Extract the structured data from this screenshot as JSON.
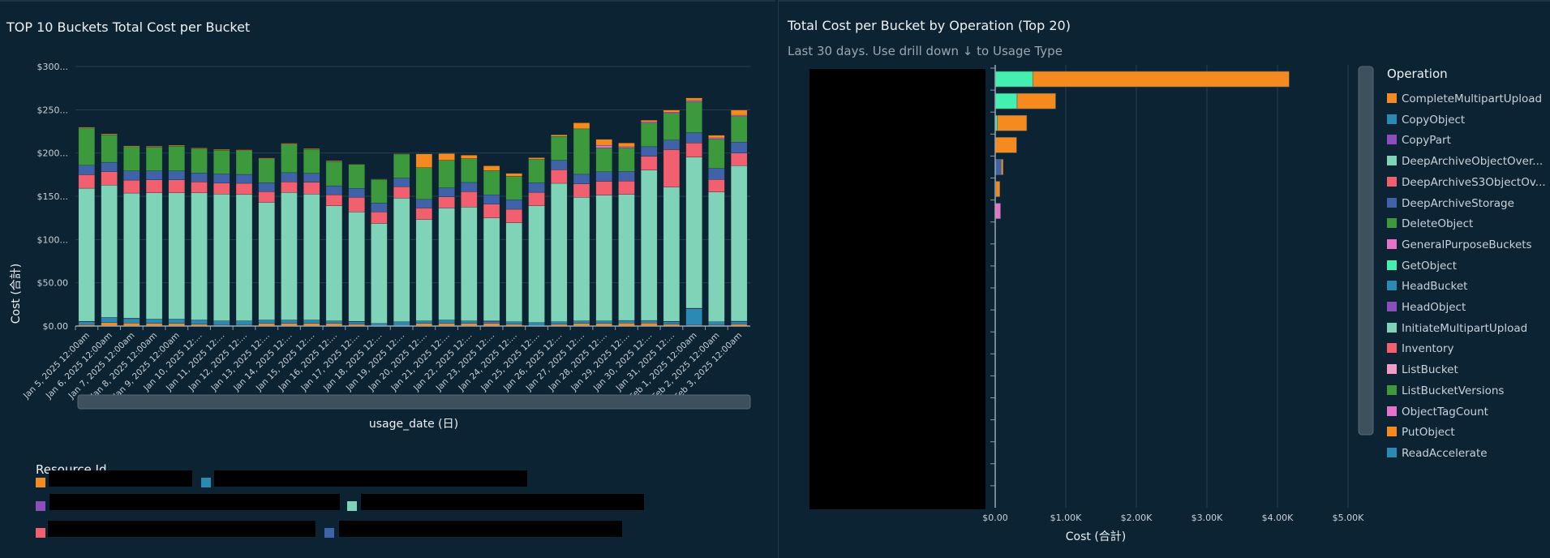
{
  "left_panel": {
    "title": "TOP 10 Buckets Total Cost per Bucket",
    "legend_title": "Resource Id",
    "legend_items": [
      {
        "color": "#F58A1F",
        "label_redacted": true
      },
      {
        "color": "#2A8AB4",
        "label_redacted": true
      },
      {
        "color": "#8A4FBA",
        "label_redacted": true
      },
      {
        "color": "#7FD4B8",
        "label_redacted": true
      },
      {
        "color": "#F25F6E",
        "label_redacted": true
      },
      {
        "color": "#4062A8",
        "label_redacted": true
      }
    ]
  },
  "right_panel": {
    "title": "Total Cost per Bucket by Operation (Top 20)",
    "subtitle": "Last 30 days. Use drill down ↓ to Usage Type",
    "legend_title": "Operation",
    "legend_items": [
      {
        "label": "CompleteMultipartUpload",
        "color": "#F58A1F"
      },
      {
        "label": "CopyObject",
        "color": "#2A8AB4"
      },
      {
        "label": "CopyPart",
        "color": "#8A4FBA"
      },
      {
        "label": "DeepArchiveObjectOver...",
        "color": "#7FD4B8"
      },
      {
        "label": "DeepArchiveS3ObjectOv...",
        "color": "#F25F6E"
      },
      {
        "label": "DeepArchiveStorage",
        "color": "#4062A8"
      },
      {
        "label": "DeleteObject",
        "color": "#3C9A3C"
      },
      {
        "label": "GeneralPurposeBuckets",
        "color": "#E573C9"
      },
      {
        "label": "GetObject",
        "color": "#43F0B0"
      },
      {
        "label": "HeadBucket",
        "color": "#2A8AB4"
      },
      {
        "label": "HeadObject",
        "color": "#8A4FBA"
      },
      {
        "label": "InitiateMultipartUpload",
        "color": "#7FD4B8"
      },
      {
        "label": "Inventory",
        "color": "#F25F6E"
      },
      {
        "label": "ListBucket",
        "color": "#F09CC8"
      },
      {
        "label": "ListBucketVersions",
        "color": "#3C9A3C"
      },
      {
        "label": "ObjectTagCount",
        "color": "#E573C9"
      },
      {
        "label": "PutObject",
        "color": "#F58A1F"
      },
      {
        "label": "ReadAccelerate",
        "color": "#2A8AB4"
      }
    ]
  },
  "chart_data": [
    {
      "type": "bar",
      "stacked": true,
      "title": "TOP 10 Buckets Total Cost per Bucket",
      "xlabel": "usage_date (日)",
      "ylabel": "Cost (合計)",
      "ylim": [
        0,
        300
      ],
      "yticks": [
        0,
        50,
        100,
        150,
        200,
        250,
        300
      ],
      "ytick_labels": [
        "$0.00",
        "$50.00",
        "$100...",
        "$150...",
        "$200...",
        "$250...",
        "$300..."
      ],
      "grid": true,
      "legend_placement": "bottom",
      "categories": [
        "Jan 5, 2025 12:00am",
        "Jan 6, 2025 12:00am",
        "Jan 7, 2025 12:00am",
        "Jan 8, 2025 12:00am",
        "Jan 9, 2025 12:00am",
        "Jan 10, 2025 12:...",
        "Jan 11, 2025 12:...",
        "Jan 12, 2025 12:...",
        "Jan 13, 2025 12:...",
        "Jan 14, 2025 12:...",
        "Jan 15, 2025 12:...",
        "Jan 16, 2025 12:...",
        "Jan 17, 2025 12:...",
        "Jan 18, 2025 12:...",
        "Jan 19, 2025 12:...",
        "Jan 20, 2025 12:...",
        "Jan 21, 2025 12:...",
        "Jan 22, 2025 12:...",
        "Jan 23, 2025 12:...",
        "Jan 24, 2025 12:...",
        "Jan 25, 2025 12:...",
        "Jan 26, 2025 12:...",
        "Jan 27, 2025 12:...",
        "Jan 28, 2025 12:...",
        "Jan 29, 2025 12:...",
        "Jan 30, 2025 12:...",
        "Jan 31, 2025 12:...",
        "Feb 1, 2025 12:00am",
        "Feb 2, 2025 12:00am",
        "Feb 3, 2025 12:00am"
      ],
      "series": [
        {
          "color": "#F58A1F",
          "values": [
            1.5,
            4,
            3.5,
            3,
            3,
            2,
            1,
            1,
            3,
            3,
            3,
            3,
            2,
            0,
            0,
            3,
            3,
            3,
            3,
            2,
            0,
            2,
            3,
            3,
            3.5,
            3.5,
            2,
            1,
            1,
            2
          ]
        },
        {
          "color": "#2A8AB4",
          "values": [
            3.4,
            6,
            5,
            5,
            5,
            5,
            5,
            5,
            4,
            4,
            4,
            3,
            3,
            3,
            5,
            3,
            4,
            3,
            2,
            3,
            4,
            3,
            3,
            3,
            3,
            3,
            3,
            19,
            4,
            3
          ]
        },
        {
          "color": "#8A4FBA",
          "values": [
            0.6,
            0,
            0.5,
            0,
            0,
            0,
            0,
            0,
            0,
            0,
            0,
            0,
            0.5,
            0,
            0,
            0,
            0,
            0,
            1,
            0,
            0,
            0,
            0,
            0,
            0,
            0,
            0.5,
            0.6,
            0,
            0.6
          ]
        },
        {
          "color": "#7FD4B8",
          "values": [
            153.8,
            152.8,
            144.7,
            146,
            146,
            146.9,
            146.6,
            146,
            136,
            147.5,
            145.6,
            133,
            126.5,
            115.6,
            143,
            117,
            129.4,
            131.6,
            119,
            114.4,
            135,
            160,
            142.8,
            145.3,
            145.6,
            173.8,
            155,
            174.7,
            150,
            179.7
          ]
        },
        {
          "color": "#F25F6E",
          "values": [
            15.6,
            15.6,
            15,
            15,
            15,
            12.8,
            12.8,
            13,
            12.5,
            12.2,
            13.7,
            12.8,
            16.9,
            13.4,
            13,
            13.4,
            13,
            17.8,
            16,
            15.6,
            15.6,
            15.6,
            15.6,
            16,
            15.6,
            16,
            43.4,
            16.3,
            14.4,
            14.7
          ]
        },
        {
          "color": "#4062A8",
          "values": [
            10.9,
            10.9,
            10.6,
            10.3,
            10.3,
            10.3,
            10.3,
            10.3,
            10.3,
            10.6,
            10.3,
            10.3,
            10.3,
            10.3,
            10,
            10,
            10.3,
            10.6,
            10.6,
            11,
            11,
            11,
            11,
            11,
            11,
            11,
            11,
            12,
            12.8,
            12.5
          ]
        },
        {
          "color": "#3C9A3C",
          "values": [
            43,
            31.9,
            28,
            27.5,
            28.7,
            27.8,
            27.5,
            27.5,
            27.5,
            33,
            27.5,
            28,
            27.5,
            27.2,
            27.8,
            36.6,
            31.9,
            27.5,
            28,
            27,
            27,
            27.5,
            52.5,
            27.5,
            27,
            27.2,
            31,
            35.6,
            33.8,
            29.7
          ]
        },
        {
          "color": "#E573C9",
          "values": [
            0,
            0,
            0,
            0,
            0,
            0,
            0,
            0,
            0,
            0,
            0,
            0,
            0,
            0,
            0,
            0,
            0,
            0,
            0,
            0,
            0,
            0,
            0,
            3,
            1.5,
            1.5,
            1.2,
            1.5,
            1.5,
            1.5
          ]
        },
        {
          "color": "#F58A1F",
          "values": [
            1,
            1,
            1,
            1,
            1,
            1,
            1,
            1,
            1,
            1,
            1,
            1,
            0.5,
            0.5,
            0.5,
            16,
            7.8,
            4,
            5.6,
            3.5,
            2,
            2,
            7,
            7,
            4.4,
            2,
            2.5,
            3,
            3,
            6
          ]
        }
      ]
    },
    {
      "type": "bar",
      "orientation": "horizontal",
      "stacked": true,
      "title": "Total Cost per Bucket by Operation (Top 20)",
      "xlabel": "Cost (合計)",
      "xlim": [
        0,
        5000
      ],
      "xticks": [
        0,
        1000,
        2000,
        3000,
        4000,
        5000
      ],
      "xtick_labels": [
        "$0.00",
        "$1.00K",
        "$2.00K",
        "$3.00K",
        "$4.00K",
        "$5.00K"
      ],
      "grid": true,
      "legend_placement": "right",
      "category_labels_redacted": true,
      "row_count": 20,
      "series": [
        {
          "name": "DeepArchiveStorage",
          "color": "#4062A8",
          "values": [
            0,
            0,
            0,
            0,
            85,
            0,
            0,
            0,
            0,
            0,
            0,
            0,
            0,
            0,
            0,
            0,
            0,
            0,
            0,
            0
          ]
        },
        {
          "name": "GeneralPurposeBuckets",
          "color": "#E573C9",
          "values": [
            0,
            0,
            0,
            0,
            0,
            0,
            75,
            0,
            0,
            0,
            0,
            0,
            0,
            0,
            0,
            0,
            0,
            0,
            0,
            0
          ]
        },
        {
          "name": "GetObject",
          "color": "#43F0B0",
          "values": [
            532,
            310,
            30,
            0,
            0,
            10,
            0,
            0,
            0,
            0,
            0,
            0,
            0,
            0,
            0,
            0,
            0,
            0,
            0,
            0
          ]
        },
        {
          "name": "PutObject",
          "color": "#F58A1F",
          "values": [
            3633,
            546,
            417,
            303,
            27,
            55,
            0,
            0,
            5,
            0,
            0,
            0,
            0,
            0,
            0,
            0,
            0,
            0,
            0,
            0
          ]
        }
      ]
    }
  ]
}
